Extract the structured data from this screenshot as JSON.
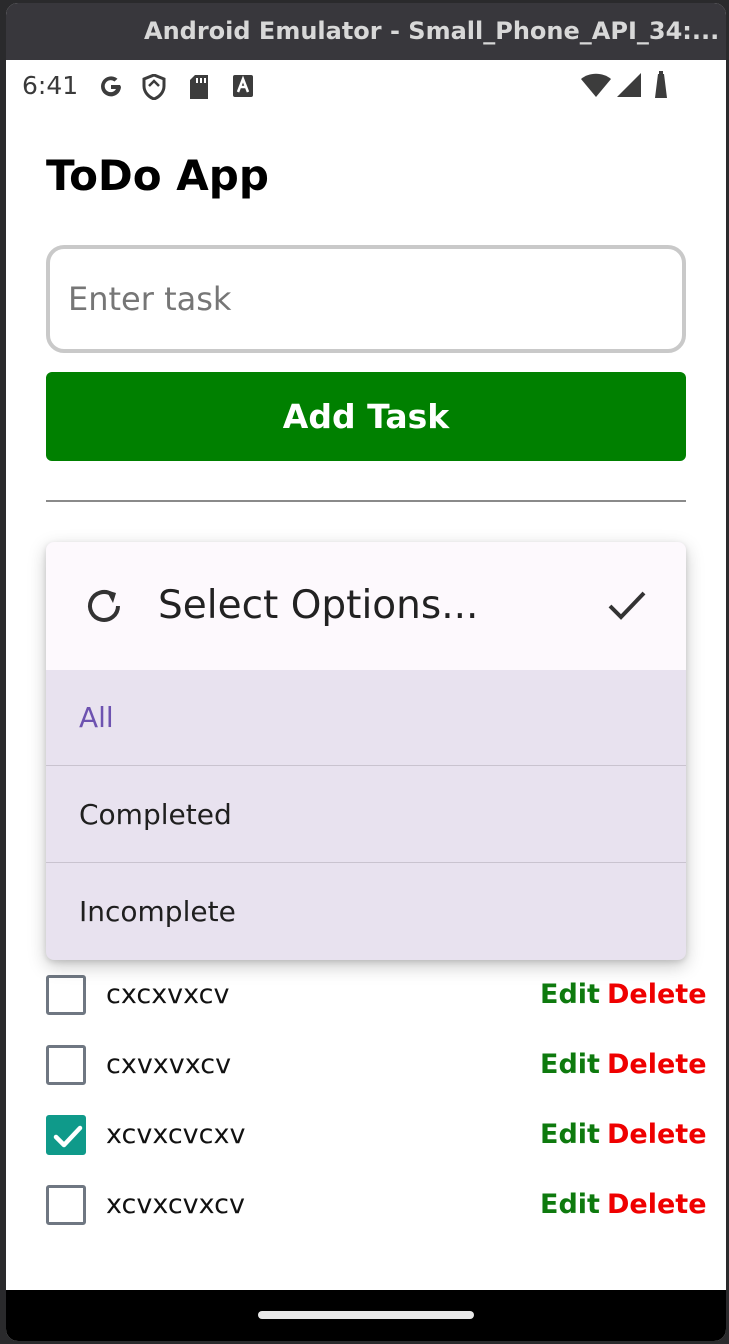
{
  "window": {
    "title": "Android Emulator - Small_Phone_API_34:..."
  },
  "status_bar": {
    "time": "6:41",
    "left_icons": [
      "google-g-icon",
      "shield-icon",
      "sd-card-icon",
      "text-a-icon"
    ],
    "right_icons": [
      "wifi-icon",
      "cellular-signal-icon",
      "battery-icon"
    ]
  },
  "app": {
    "title": "ToDo App",
    "input": {
      "placeholder": "Enter task",
      "value": ""
    },
    "add_button": "Add Task",
    "colors": {
      "add_button": "#008000",
      "edit": "#0e7a0e",
      "delete": "#ef0000",
      "checkbox_checked": "#0f9a8a",
      "selected_option": "#6d52b0"
    }
  },
  "filter_dropdown": {
    "placeholder": "Select Options...",
    "options": [
      {
        "label": "All",
        "selected": true
      },
      {
        "label": "Completed",
        "selected": false
      },
      {
        "label": "Incomplete",
        "selected": false
      }
    ]
  },
  "tasks": [
    {
      "text": "cxcxvxcv",
      "completed": false,
      "edit_label": "Edit",
      "delete_label": "Delete"
    },
    {
      "text": "cxvxvxcv",
      "completed": false,
      "edit_label": "Edit",
      "delete_label": "Delete"
    },
    {
      "text": "xcvxcvcxv",
      "completed": true,
      "edit_label": "Edit",
      "delete_label": "Delete"
    },
    {
      "text": "xcvxcvxcv",
      "completed": false,
      "edit_label": "Edit",
      "delete_label": "Delete"
    }
  ]
}
